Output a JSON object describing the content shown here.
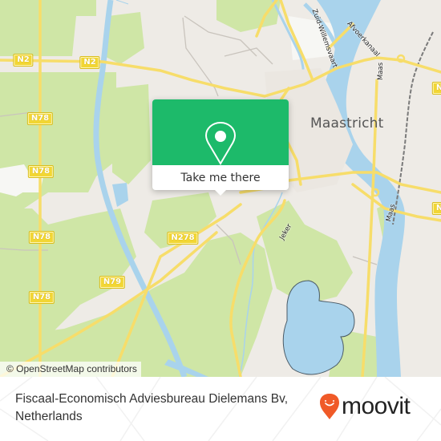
{
  "map": {
    "city_label": "Maastricht",
    "water_labels": {
      "maas_north": "Maas",
      "maas_south": "Maas",
      "zuid_willemsvaart": "Zuid-Willemsvaart",
      "afvoerkanaal": "Afvoerkanaal",
      "jeker": "Jeker"
    },
    "road_badges": [
      {
        "id": "n2-west",
        "label": "N2"
      },
      {
        "id": "n2-east",
        "label": "N2"
      },
      {
        "id": "n78-1",
        "label": "N78"
      },
      {
        "id": "n78-2",
        "label": "N78"
      },
      {
        "id": "n78-3",
        "label": "N78"
      },
      {
        "id": "n78-4",
        "label": "N78"
      },
      {
        "id": "n79",
        "label": "N79"
      },
      {
        "id": "n278",
        "label": "N278"
      },
      {
        "id": "n-east-1",
        "label": "N"
      },
      {
        "id": "n-east-2",
        "label": "N"
      }
    ],
    "attribution": "© OpenStreetMap contributors",
    "colors": {
      "land": "#eeebe6",
      "forest": "#cfe6a6",
      "water": "#a9d3ec",
      "road": "#f7dd6a"
    }
  },
  "popup": {
    "icon": "map-pin-icon",
    "button_label": "Take me there",
    "color": "#1dba6a"
  },
  "footer": {
    "place_name": "Fiscaal-Economisch Adviesbureau Dielemans Bv, Netherlands",
    "brand": "moovit",
    "brand_color": "#f05a28"
  }
}
